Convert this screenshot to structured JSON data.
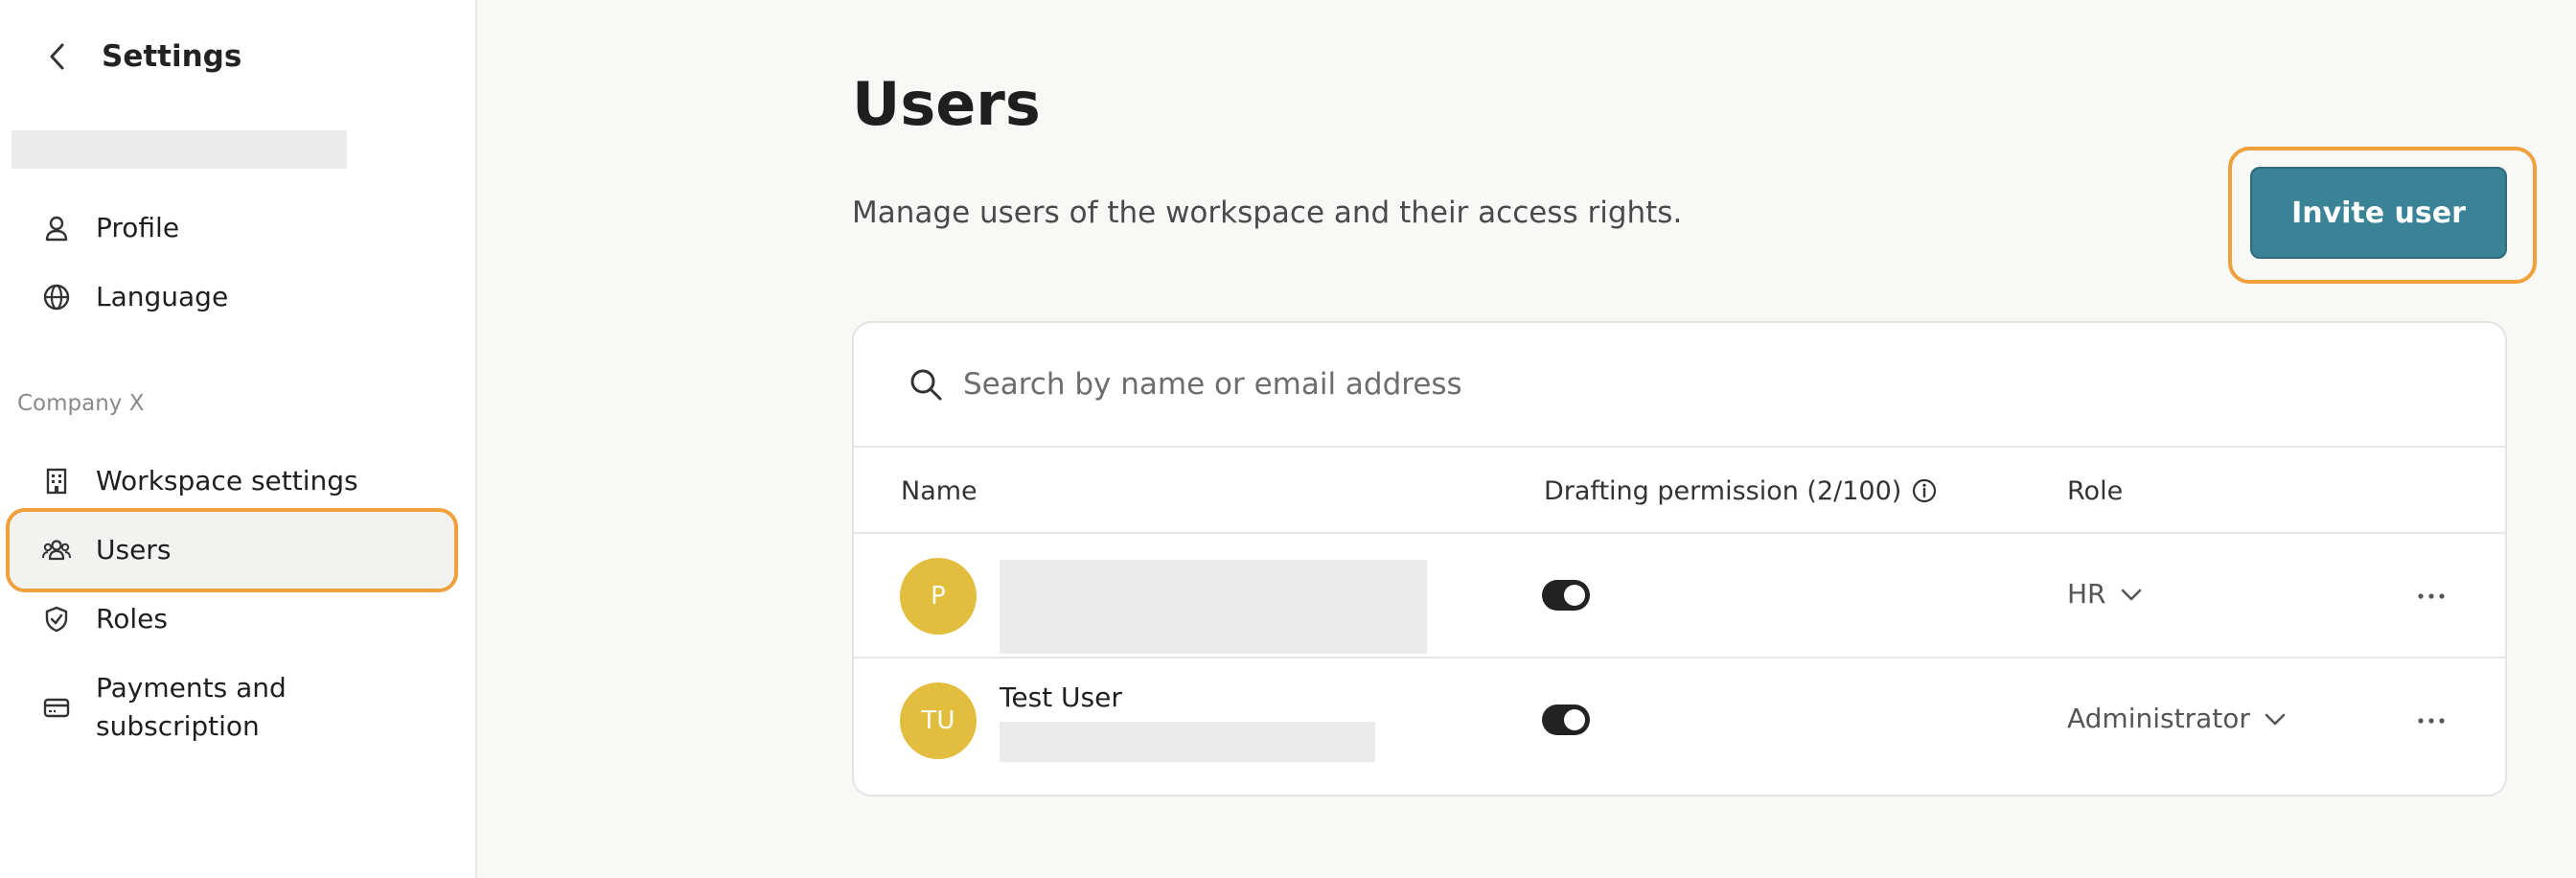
{
  "sidebar": {
    "title": "Settings",
    "personal_items": [
      {
        "label": "Profile",
        "icon": "person-icon"
      },
      {
        "label": "Language",
        "icon": "globe-icon"
      }
    ],
    "section_label": "Company X",
    "company_items": [
      {
        "label": "Workspace settings",
        "icon": "building-icon"
      },
      {
        "label": "Users",
        "icon": "users-icon",
        "active": true
      },
      {
        "label": "Roles",
        "icon": "shield-check-icon"
      },
      {
        "label": "Payments and subscription",
        "icon": "credit-card-icon"
      }
    ]
  },
  "main": {
    "title": "Users",
    "description": "Manage users of the workspace and their access rights.",
    "invite_button": "Invite user",
    "search_placeholder": "Search by name or email address",
    "columns": {
      "name": "Name",
      "drafting": "Drafting permission (2/100)",
      "role": "Role"
    },
    "users": [
      {
        "initials": "P",
        "name": "",
        "drafting_enabled": true,
        "role": "HR"
      },
      {
        "initials": "TU",
        "name": "Test User",
        "drafting_enabled": true,
        "role": "Administrator"
      }
    ]
  },
  "colors": {
    "accent_outline": "#f0a13c",
    "invite_button": "#3a8296",
    "avatar": "#e2bd3e",
    "toggle_on": "#222222"
  }
}
